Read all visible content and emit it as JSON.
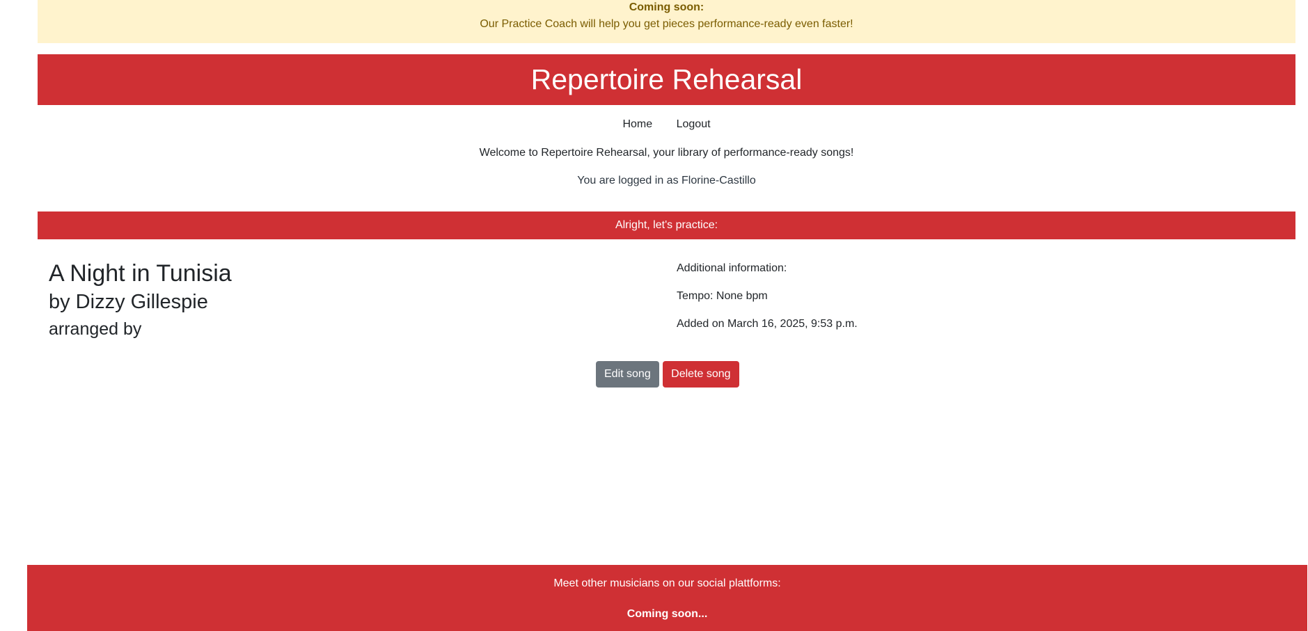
{
  "announcement": {
    "title": "Coming soon:",
    "text": "Our Practice Coach will help you get pieces performance-ready even faster!"
  },
  "header": {
    "title": "Repertoire Rehearsal"
  },
  "nav": {
    "items": [
      {
        "label": "Home"
      },
      {
        "label": "Logout"
      }
    ]
  },
  "welcome": "Welcome to Repertoire Rehearsal, your library of performance-ready songs!",
  "login_status": "You are logged in as Florine-Castillo",
  "practice_banner": "Alright, let's practice:",
  "song": {
    "title": "A Night in Tunisia",
    "artist": "by Dizzy Gillespie",
    "arranger": "arranged by",
    "info_heading": "Additional information:",
    "tempo": "Tempo: None bpm",
    "added": "Added on March 16, 2025, 9:53 p.m."
  },
  "actions": {
    "edit_label": "Edit song",
    "delete_label": "Delete song"
  },
  "footer": {
    "text": "Meet other musicians on our social plattforms:",
    "coming_soon": "Coming soon..."
  },
  "colors": {
    "brand_red": "#cf3034",
    "announce_bg": "#fff3cd",
    "announce_text": "#7a5c00",
    "edit_button": "#6c757d"
  }
}
